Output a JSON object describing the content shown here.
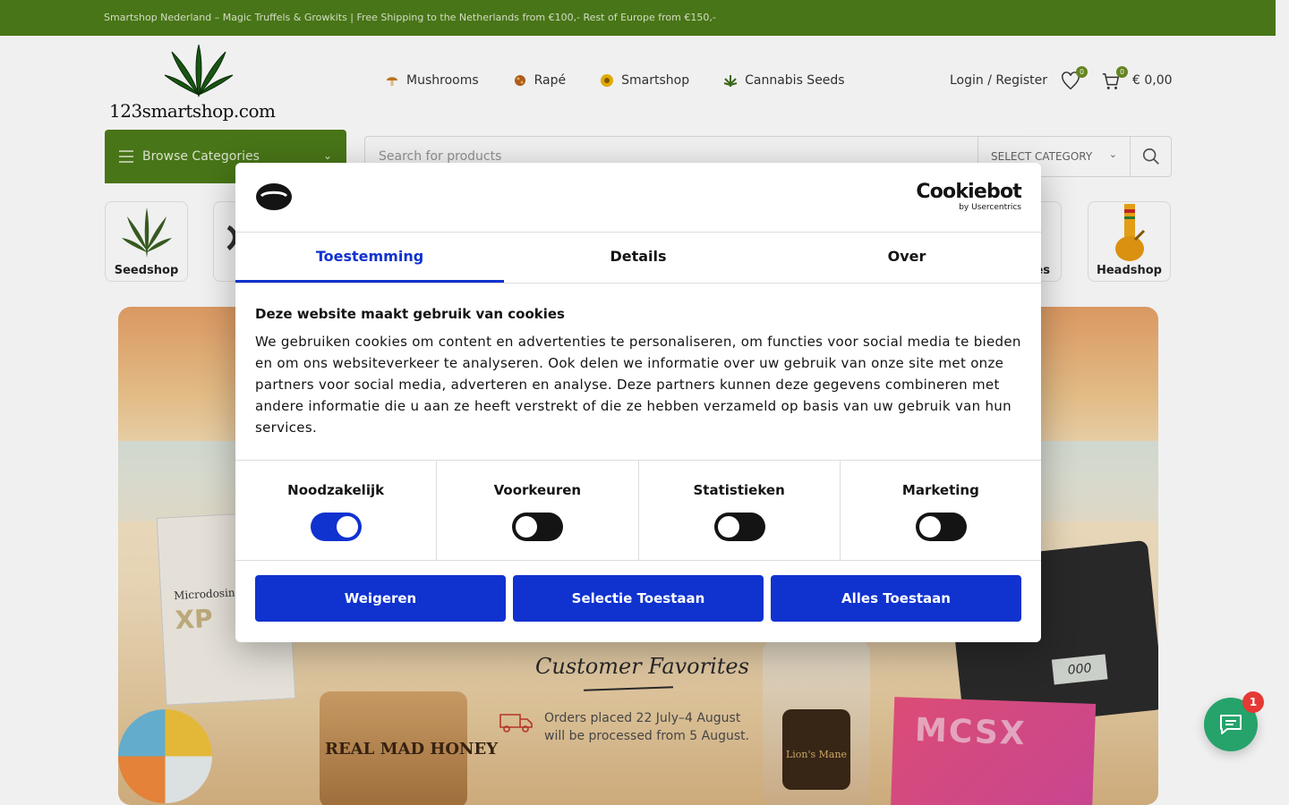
{
  "topbar": {
    "text": "Smartshop Nederland – Magic Truffels & Growkits | Free Shipping to the Netherlands from €100,- Rest of Europe from €150,-"
  },
  "header": {
    "logo_text": "123smartshop.com",
    "nav": [
      {
        "label": "Mushrooms",
        "icon": "mushroom-icon"
      },
      {
        "label": "Rapé",
        "icon": "rape-icon"
      },
      {
        "label": "Smartshop",
        "icon": "smartshop-icon"
      },
      {
        "label": "Cannabis Seeds",
        "icon": "cannabis-leaf-icon"
      }
    ],
    "account_label": "Login / Register",
    "wishlist_count": "0",
    "cart_count": "0",
    "cart_total": "€ 0,00"
  },
  "browse": {
    "label": "Browse Categories"
  },
  "search": {
    "placeholder": "Search for products",
    "category_label": "SELECT CATEGORY"
  },
  "tiles": [
    {
      "label": "Seedshop"
    },
    {
      "label": "es"
    },
    {
      "label": "Headshop"
    }
  ],
  "banner": {
    "title": "Customer Favorites",
    "note_line1": "Orders placed 22 July–4 August",
    "note_line2": "will be processed from 5 August.",
    "product1_line1": "Microdosing",
    "product1_line2": "XP",
    "product2": "REAL MAD HONEY",
    "product3": "Lion's Mane",
    "product4": "MCSX",
    "scale_readout": "000"
  },
  "cookie_dialog": {
    "brand": "Cookiebot",
    "brand_sub": "by Usercentrics",
    "tabs": [
      {
        "label": "Toestemming",
        "active": true
      },
      {
        "label": "Details",
        "active": false
      },
      {
        "label": "Over",
        "active": false
      }
    ],
    "heading": "Deze website maakt gebruik van cookies",
    "body": "We gebruiken cookies om content en advertenties te personaliseren, om functies voor social media te bieden en om ons websiteverkeer te analyseren. Ook delen we informatie over uw gebruik van onze site met onze partners voor social media, adverteren en analyse. Deze partners kunnen deze gegevens combineren met andere informatie die u aan ze heeft verstrekt of die ze hebben verzameld op basis van uw gebruik van hun services.",
    "toggles": [
      {
        "label": "Noodzakelijk",
        "checked": true
      },
      {
        "label": "Voorkeuren",
        "checked": false
      },
      {
        "label": "Statistieken",
        "checked": false
      },
      {
        "label": "Marketing",
        "checked": false
      }
    ],
    "buttons": {
      "deny": "Weigeren",
      "allow_selection": "Selectie Toestaan",
      "allow_all": "Alles Toestaan"
    },
    "accent_color": "#1032cf"
  },
  "chat": {
    "unread": "1",
    "icon": "chat-icon",
    "color": "#25a36b"
  },
  "colors": {
    "brand_green": "#4d7d19"
  }
}
